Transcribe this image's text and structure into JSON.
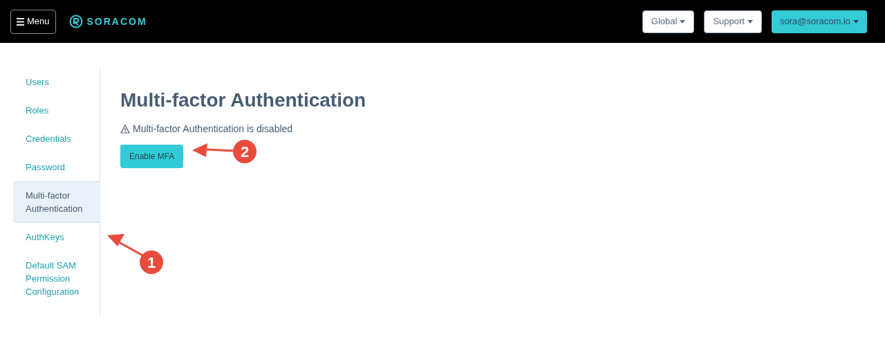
{
  "header": {
    "menu_button": "Menu",
    "logo": "SORACOM",
    "buttons": [
      {
        "label": "Global",
        "kind": "light"
      },
      {
        "label": "Support",
        "kind": "light"
      },
      {
        "label": "sora@soracom.io",
        "kind": "primary"
      }
    ]
  },
  "sidebar": {
    "items": [
      {
        "label": "Users",
        "selected": false
      },
      {
        "label": "Roles",
        "selected": false
      },
      {
        "label": "Credentials",
        "selected": false
      },
      {
        "label": "Password",
        "selected": false
      },
      {
        "label": "Multi-factor Authentication",
        "selected": true
      },
      {
        "label": "AuthKeys",
        "selected": false
      },
      {
        "label": "Default SAM Permission Configuration",
        "selected": false
      }
    ]
  },
  "main": {
    "title": "Multi-factor Authentication",
    "status": "Multi-factor Authentication is disabled",
    "button": "Enable MFA"
  },
  "annotations": [
    {
      "label": "1"
    },
    {
      "label": "2"
    }
  ]
}
